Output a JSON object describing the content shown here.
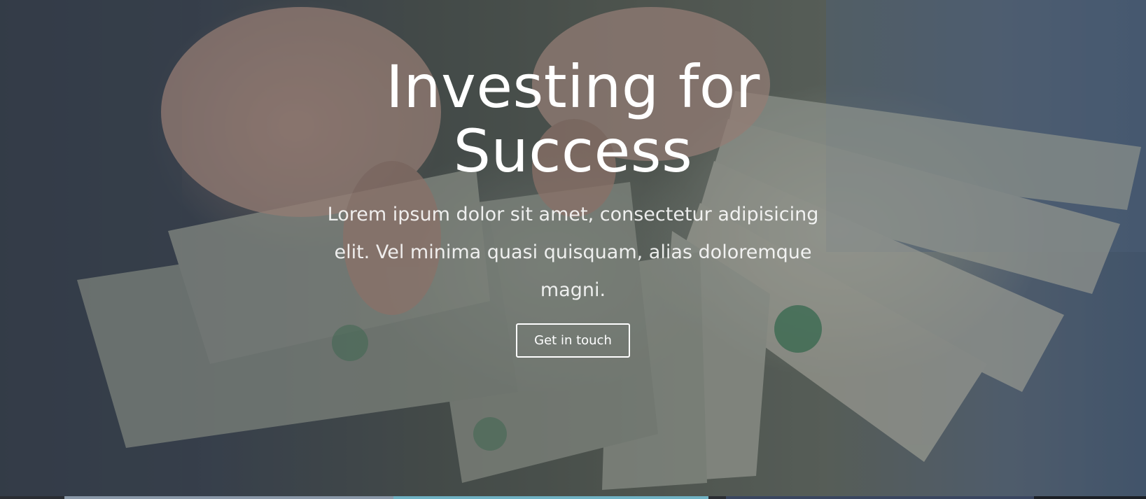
{
  "hero": {
    "title": "Investing for Success",
    "lead": "Lorem ipsum dolor sit amet, consectetur adipisicing elit. Vel minima quasi quisquam, alias doloremque magni.",
    "cta_label": "Get in touch",
    "background_image": "hands-counting-dollar-bills-photo"
  },
  "colors": {
    "text": "#ffffff",
    "overlay": "rgba(20, 24, 30, 0.35)"
  }
}
